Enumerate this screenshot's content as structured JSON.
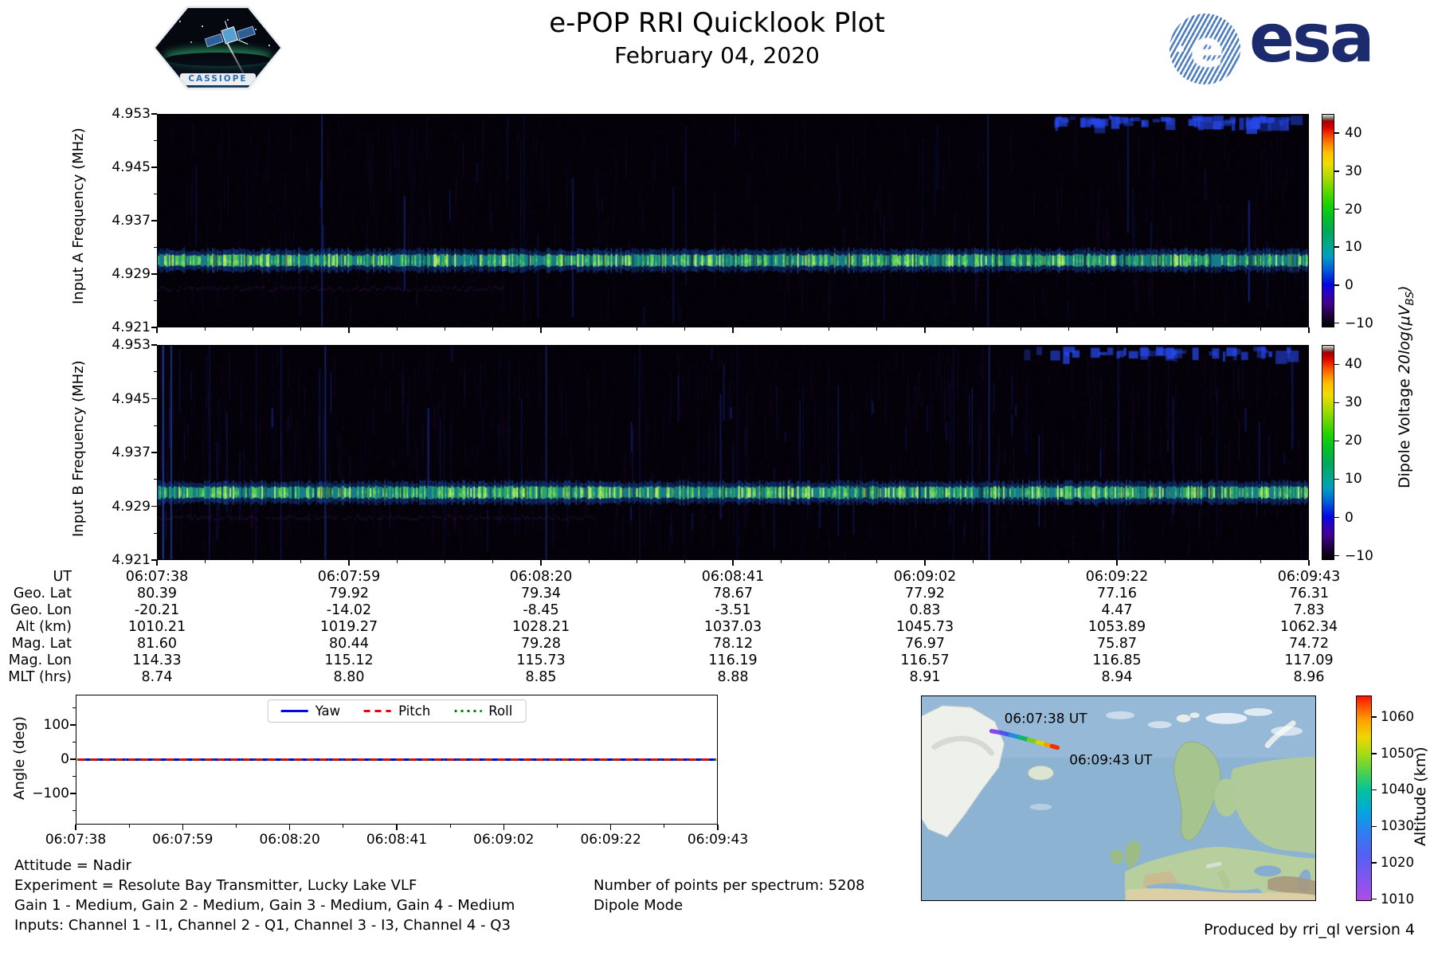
{
  "header": {
    "title": "e-POP RRI Quicklook Plot",
    "date": "February 04, 2020",
    "cassiope_patch_label": "CASSIOPE",
    "esa_wordmark": "esa",
    "esa_globe_letter": "e"
  },
  "chart_data": [
    {
      "id": "spectrogram_input_a",
      "type": "heatmap",
      "ylabel": "Input A Frequency (MHz)",
      "ylim": [
        4.921,
        4.953
      ],
      "yticks": [
        "4.953",
        "4.945",
        "4.937",
        "4.929",
        "4.921"
      ],
      "xticks_ut": [
        "06:07:38",
        "06:07:59",
        "06:08:20",
        "06:08:41",
        "06:09:02",
        "06:09:22",
        "06:09:43"
      ],
      "signal": {
        "band_center_mhz": 4.931,
        "band_level": "10-25 dB continuous green-yellow transmitter band",
        "background": "black / faint purple noise, sparse faint blue vertical interference streaks",
        "features": [
          "blue dashed bursts along top edge near end of pass",
          "faint purple horizontal smear below band at start"
        ]
      },
      "colorbar": {
        "label_prefix": "Dipole Voltage ",
        "label_math": "20log(μV",
        "label_sub": "BS",
        "label_suffix": ")",
        "ticks": [
          "40",
          "30",
          "20",
          "10",
          "0",
          "−10"
        ],
        "range": [
          -11,
          45
        ]
      }
    },
    {
      "id": "spectrogram_input_b",
      "type": "heatmap",
      "ylabel": "Input B Frequency (MHz)",
      "ylim": [
        4.921,
        4.953
      ],
      "yticks": [
        "4.953",
        "4.945",
        "4.937",
        "4.929",
        "4.921"
      ],
      "xticks_ut": [
        "06:07:38",
        "06:07:59",
        "06:08:20",
        "06:08:41",
        "06:09:02",
        "06:09:22",
        "06:09:43"
      ],
      "signal": {
        "band_center_mhz": 4.931,
        "band_level": "10-25 dB continuous green-yellow transmitter band",
        "background": "black with many blue vertical interference streaks, strongest at start of pass",
        "features": [
          "bright full-height blue lines at left edge",
          "blue dashed bursts along top edge near end of pass"
        ]
      },
      "colorbar": {
        "ticks": [
          "40",
          "30",
          "20",
          "10",
          "0",
          "−10"
        ],
        "range": [
          -11,
          45
        ]
      }
    },
    {
      "id": "ephemeris_table",
      "type": "table",
      "row_labels": [
        "UT",
        "Geo. Lat",
        "Geo. Lon",
        "Alt (km)",
        "Mag. Lat",
        "Mag. Lon",
        "MLT (hrs)"
      ],
      "columns": [
        [
          "06:07:38",
          "80.39",
          "-20.21",
          "1010.21",
          "81.60",
          "114.33",
          "8.74"
        ],
        [
          "06:07:59",
          "79.92",
          "-14.02",
          "1019.27",
          "80.44",
          "115.12",
          "8.80"
        ],
        [
          "06:08:20",
          "79.34",
          "-8.45",
          "1028.21",
          "79.28",
          "115.73",
          "8.85"
        ],
        [
          "06:08:41",
          "78.67",
          "-3.51",
          "1037.03",
          "78.12",
          "116.19",
          "8.88"
        ],
        [
          "06:09:02",
          "77.92",
          "0.83",
          "1045.73",
          "76.97",
          "116.57",
          "8.91"
        ],
        [
          "06:09:22",
          "77.16",
          "4.47",
          "1053.89",
          "75.87",
          "116.85",
          "8.94"
        ],
        [
          "06:09:43",
          "76.31",
          "7.83",
          "1062.34",
          "74.72",
          "117.09",
          "8.96"
        ]
      ]
    },
    {
      "id": "attitude_plot",
      "type": "line",
      "ylabel": "Angle (deg)",
      "yticks": [
        "100",
        "0",
        "−100"
      ],
      "ylim": [
        -186,
        186
      ],
      "xticks": [
        "06:07:38",
        "06:07:59",
        "06:08:20",
        "06:08:41",
        "06:09:02",
        "06:09:22",
        "06:09:43"
      ],
      "legend_position": "top center",
      "series": [
        {
          "name": "Yaw",
          "color": "#0008dd",
          "style": "solid",
          "values": [
            0,
            0,
            0,
            0,
            0,
            0,
            0
          ]
        },
        {
          "name": "Pitch",
          "color": "#e8000b",
          "style": "dashed",
          "values": [
            0,
            0,
            0,
            0,
            0,
            0,
            0
          ]
        },
        {
          "name": "Roll",
          "color": "#007f00",
          "style": "dotted",
          "values": [
            0,
            0,
            0,
            0,
            0,
            0,
            0
          ]
        }
      ]
    },
    {
      "id": "ground_track_map",
      "type": "scatter",
      "region": "North Atlantic / Greenland / Europe",
      "track_start_label": "06:07:38 UT",
      "track_end_label": "06:09:43 UT",
      "track_altitude_km": [
        1010.21,
        1062.34
      ],
      "colorbar": {
        "label": "Altitude (km)",
        "ticks": [
          "1060",
          "1050",
          "1040",
          "1030",
          "1020",
          "1010"
        ],
        "range": [
          1009,
          1066
        ]
      }
    }
  ],
  "footer": {
    "attitude": "Attitude = Nadir",
    "experiment": "Experiment = Resolute Bay Transmitter, Lucky Lake VLF",
    "gains": "Gain 1 - Medium, Gain 2 - Medium, Gain 3 - Medium, Gain 4 - Medium",
    "inputs": "Inputs: Channel 1 - I1, Channel 2 - Q1, Channel 3 - I3, Channel 4 - Q3",
    "points_per_spectrum": "Number of points per spectrum: 5208",
    "mode": "Dipole Mode",
    "produced_by": "Produced by rri_ql version 4"
  }
}
